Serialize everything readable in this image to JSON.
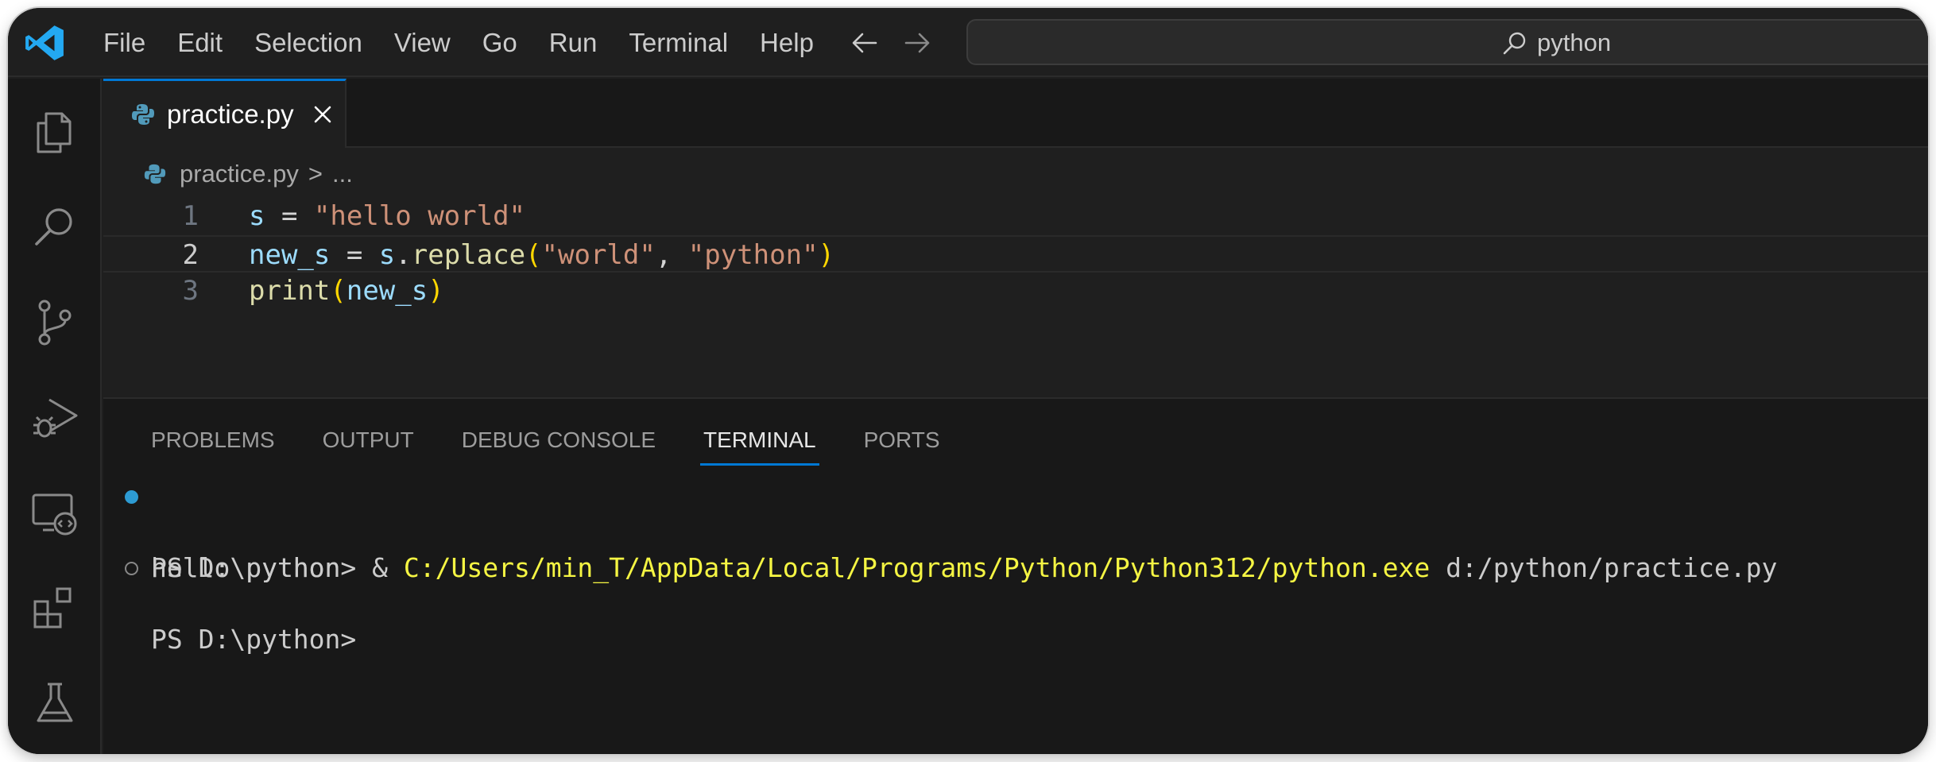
{
  "menu": [
    "File",
    "Edit",
    "Selection",
    "View",
    "Go",
    "Run",
    "Terminal",
    "Help"
  ],
  "search": {
    "value": "python"
  },
  "activity_icons": [
    "explorer-icon",
    "search-icon",
    "source-control-icon",
    "run-debug-icon",
    "remote-explorer-icon",
    "extensions-icon",
    "testing-icon"
  ],
  "editor": {
    "tab_label": "practice.py",
    "breadcrumb": {
      "file": "practice.py",
      "separator": ">",
      "more": "..."
    },
    "current_line": 2,
    "lines": [
      {
        "number": "1",
        "tokens": [
          {
            "text": "s",
            "type": "var"
          },
          {
            "text": " = ",
            "type": "op"
          },
          {
            "text": "\"hello world\"",
            "type": "str"
          }
        ]
      },
      {
        "number": "2",
        "tokens": [
          {
            "text": "new_s",
            "type": "var"
          },
          {
            "text": " = ",
            "type": "op"
          },
          {
            "text": "s",
            "type": "var"
          },
          {
            "text": ".",
            "type": "op"
          },
          {
            "text": "replace",
            "type": "fn"
          },
          {
            "text": "(",
            "type": "par"
          },
          {
            "text": "\"world\"",
            "type": "str"
          },
          {
            "text": ", ",
            "type": "op"
          },
          {
            "text": "\"python\"",
            "type": "str"
          },
          {
            "text": ")",
            "type": "par"
          }
        ]
      },
      {
        "number": "3",
        "tokens": [
          {
            "text": "print",
            "type": "fn"
          },
          {
            "text": "(",
            "type": "par"
          },
          {
            "text": "new_s",
            "type": "var"
          },
          {
            "text": ")",
            "type": "par"
          }
        ]
      }
    ]
  },
  "panel": {
    "tabs": [
      "PROBLEMS",
      "OUTPUT",
      "DEBUG CONSOLE",
      "TERMINAL",
      "PORTS"
    ],
    "active_tab": "TERMINAL",
    "terminal": {
      "line1_prompt": "PS D:\\python> & ",
      "line1_exe": "C:/Users/min_T/AppData/Local/Programs/Python/Python312/python.exe",
      "line1_arg": " d:/python/practice.py",
      "line2": "hello python",
      "line3": "PS D:\\python>"
    }
  },
  "colors": {
    "accent": "#0078d4",
    "terminal_path": "#f5f543",
    "string": "#ce9178",
    "variable": "#9cdcfe",
    "function": "#dcdcaa"
  }
}
